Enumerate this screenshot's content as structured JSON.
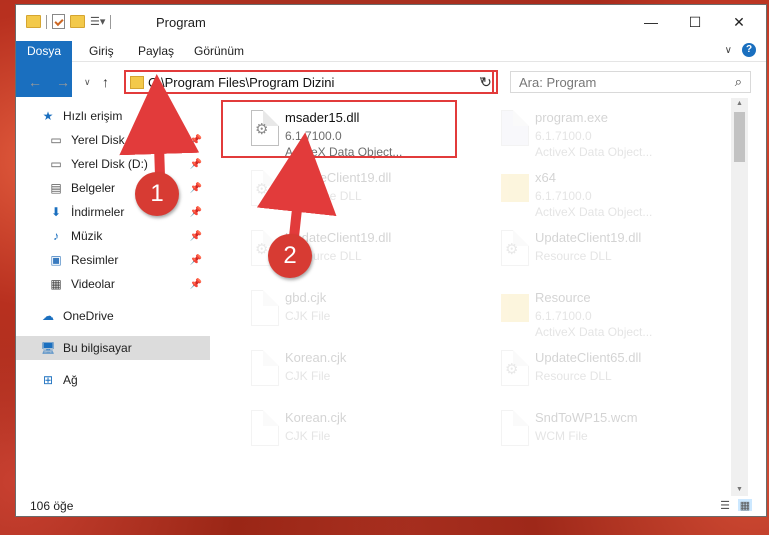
{
  "window": {
    "title": "Program",
    "minimize": "—",
    "maximize": "☐",
    "close": "✕"
  },
  "ribbon": {
    "tabs": [
      "Dosya",
      "Giriş",
      "Paylaş",
      "Görünüm"
    ],
    "collapse": "∨",
    "help": "?"
  },
  "nav": {
    "back": "←",
    "forward": "→",
    "recent": "∨",
    "up": "↑",
    "address": "C:\\Program Files\\Program Dizini",
    "address_drop": "∨",
    "refresh": "↻",
    "search_placeholder": "Ara: Program",
    "search_icon": "⌕"
  },
  "sidebar": {
    "items": [
      {
        "label": "Hızlı erişim",
        "icon": "star-icon",
        "pinned": false
      },
      {
        "label": "Yerel Disk (C:)",
        "icon": "drive-icon",
        "pinned": true
      },
      {
        "label": "Yerel Disk (D:)",
        "icon": "drive-icon",
        "pinned": true
      },
      {
        "label": "Belgeler",
        "icon": "documents-icon",
        "pinned": true
      },
      {
        "label": "İndirmeler",
        "icon": "download-icon",
        "pinned": true
      },
      {
        "label": "Müzik",
        "icon": "music-icon",
        "pinned": true
      },
      {
        "label": "Resimler",
        "icon": "pictures-icon",
        "pinned": true
      },
      {
        "label": "Videolar",
        "icon": "videos-icon",
        "pinned": true
      },
      {
        "label": "OneDrive",
        "icon": "cloud-icon",
        "pinned": false
      },
      {
        "label": "Bu bilgisayar",
        "icon": "computer-icon",
        "pinned": false,
        "selected": true
      },
      {
        "label": "Ağ",
        "icon": "network-icon",
        "pinned": false
      }
    ]
  },
  "files": [
    {
      "name": "msader15.dll",
      "line2": "6.1.7100.0",
      "line3": "ActiveX Data Object...",
      "icon": "dll-gear-icon"
    },
    {
      "name": "program.exe",
      "line2": "6.1.7100.0",
      "line3": "ActiveX Data Object...",
      "icon": "exe-icon"
    },
    {
      "name": "UpdateClient19.dll",
      "line2": "Resource DLL",
      "line3": "",
      "icon": "dll-gear-icon"
    },
    {
      "name": "x64",
      "line2": "6.1.7100.0",
      "line3": "ActiveX Data Object...",
      "icon": "folder-icon"
    },
    {
      "name": "UpdateClient19.dll",
      "line2": "Resource DLL",
      "line3": "",
      "icon": "dll-gear-icon"
    },
    {
      "name": "UpdateClient19.dll",
      "line2": "Resource DLL",
      "line3": "",
      "icon": "dll-gear-icon"
    },
    {
      "name": "gbd.cjk",
      "line2": "CJK File",
      "line3": "",
      "icon": "document-icon"
    },
    {
      "name": "Resource",
      "line2": "6.1.7100.0",
      "line3": "ActiveX Data Object...",
      "icon": "folder-icon"
    },
    {
      "name": "Korean.cjk",
      "line2": "CJK File",
      "line3": "",
      "icon": "document-icon"
    },
    {
      "name": "UpdateClient65.dll",
      "line2": "Resource DLL",
      "line3": "",
      "icon": "dll-gear-icon"
    },
    {
      "name": "Korean.cjk",
      "line2": "CJK File",
      "line3": "",
      "icon": "document-icon"
    },
    {
      "name": "SndToWP15.wcm",
      "line2": "WCM File",
      "line3": "",
      "icon": "document-icon"
    }
  ],
  "status": {
    "count": "106 öğe"
  },
  "callouts": [
    "1",
    "2"
  ],
  "colors": {
    "accent": "#1a6fbf",
    "highlight": "#e23b3b",
    "callout": "#d73b33"
  }
}
